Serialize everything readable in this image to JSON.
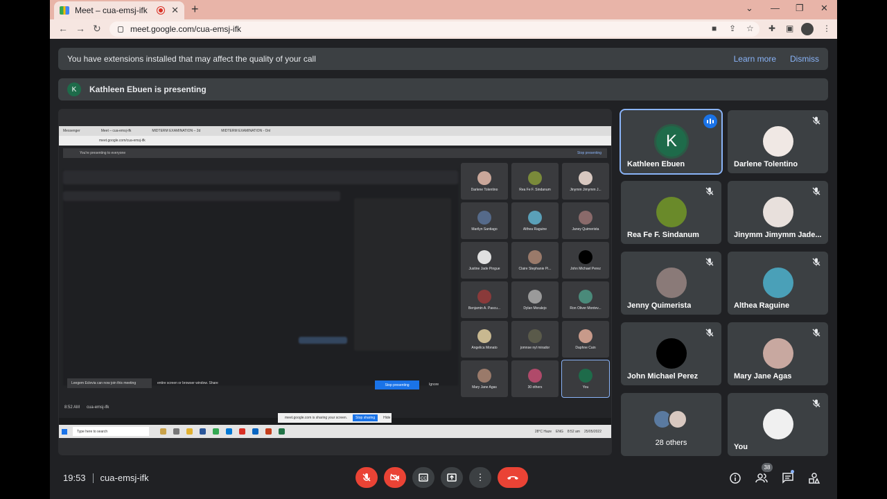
{
  "browser": {
    "tab_title": "Meet – cua-emsj-ifk",
    "url": "meet.google.com/cua-emsj-ifk",
    "new_tab_icon": "plus-icon"
  },
  "extension_banner": {
    "message": "You have extensions installed that may affect the quality of your call",
    "learn_more": "Learn more",
    "dismiss": "Dismiss"
  },
  "presenter_banner": {
    "initial": "K",
    "text": "Kathleen Ebuen is presenting"
  },
  "shared_screen": {
    "tabs": [
      "Messenger",
      "Meet – cua-emsj-ifk",
      "MIDTERM EXAMINATION – 2d",
      "MIDTERM EXAMINATION - Onl"
    ],
    "url": "meet.google.com/cua-emsj-ifk",
    "presenting_bar": "You're presenting to everyone",
    "stop_presenting_link": "Stop presenting",
    "tiles": [
      {
        "name": "Darlene Tolentino",
        "color": "#caa79a"
      },
      {
        "name": "Rea Fe F. Sindanum",
        "color": "#7a8a3a"
      },
      {
        "name": "Jinymm Jimymm J...",
        "color": "#d8c8c0"
      },
      {
        "name": "Marilyn Santiago",
        "color": "#556a8a"
      },
      {
        "name": "Althea Raguine",
        "color": "#5aa0b8"
      },
      {
        "name": "Janey Quimerista",
        "color": "#8a6a6a"
      },
      {
        "name": "Justine Jade Pingue",
        "color": "#e0e0e0"
      },
      {
        "name": "Claire Stephanie Pi...",
        "color": "#9a7a6a"
      },
      {
        "name": "John Michael Perez",
        "color": "#000000"
      },
      {
        "name": "Benjamin A. Pascu...",
        "color": "#8a3a3a"
      },
      {
        "name": "Dylan Moralejo",
        "color": "#9a9a9a"
      },
      {
        "name": "Ron Oliver Montev...",
        "color": "#4a8a7a"
      },
      {
        "name": "Angelica Monato",
        "color": "#c8b890"
      },
      {
        "name": "jomnse nyl mirador",
        "color": "#5a5a4a"
      },
      {
        "name": "Daphne Cain",
        "color": "#c89a8a"
      },
      {
        "name": "Mary Jane Agas",
        "color": "#9a7a6a"
      },
      {
        "name": "30 others",
        "color": "#b04a6a"
      },
      {
        "name": "You",
        "color": "#1e6b4a"
      }
    ],
    "notification": "Leegem Eclevia can now join this meeting",
    "share_prompt": "entire screen or browser window. Share",
    "stop_presenting_button": "Stop presenting",
    "ignore": "Ignore",
    "time": "8:52 AM",
    "meeting_code": "cua-emsj-ifk",
    "sharing_message": "meet.google.com is sharing your screen.",
    "stop_sharing": "Stop sharing",
    "hide": "Hide",
    "taskbar_search": "Type here to search",
    "weather": "28°C Haze",
    "lang": "ENG",
    "clock_time": "8:52 am",
    "clock_date": "25/05/2022"
  },
  "participants": [
    {
      "name": "Kathleen Ebuen",
      "initial": "K",
      "active": true,
      "color": "#1e6b4a"
    },
    {
      "name": "Darlene Tolentino",
      "color": "#f0e8e4",
      "muted_icon": "mic-off-icon"
    },
    {
      "name": "Rea Fe F. Sindanum",
      "color": "#6a8a2a",
      "muted_icon": "mic-off-icon"
    },
    {
      "name": "Jinymm Jimymm Jade...",
      "color": "#e8e0dc",
      "muted_icon": "mic-off-icon"
    },
    {
      "name": "Jenny Quimerista",
      "color": "#8a7a78",
      "muted_icon": "mic-off-icon"
    },
    {
      "name": "Althea Raguine",
      "color": "#4aa0b8",
      "muted_icon": "mic-off-icon"
    },
    {
      "name": "John Michael Perez",
      "color": "#000000",
      "muted_icon": "mic-off-icon"
    },
    {
      "name": "Mary Jane Agas",
      "color": "#c8a8a0",
      "muted_icon": "mic-off-icon"
    },
    {
      "name": "28 others",
      "others": true
    },
    {
      "name": "You",
      "color": "#f0f0f0",
      "muted_icon": "mic-off-icon"
    }
  ],
  "bottom_bar": {
    "time": "19:53",
    "meeting_code": "cua-emsj-ifk",
    "people_count": "38"
  },
  "colors": {
    "accent": "#8ab4f8",
    "danger": "#ea4335",
    "surface": "#3c4043",
    "background": "#202124"
  }
}
